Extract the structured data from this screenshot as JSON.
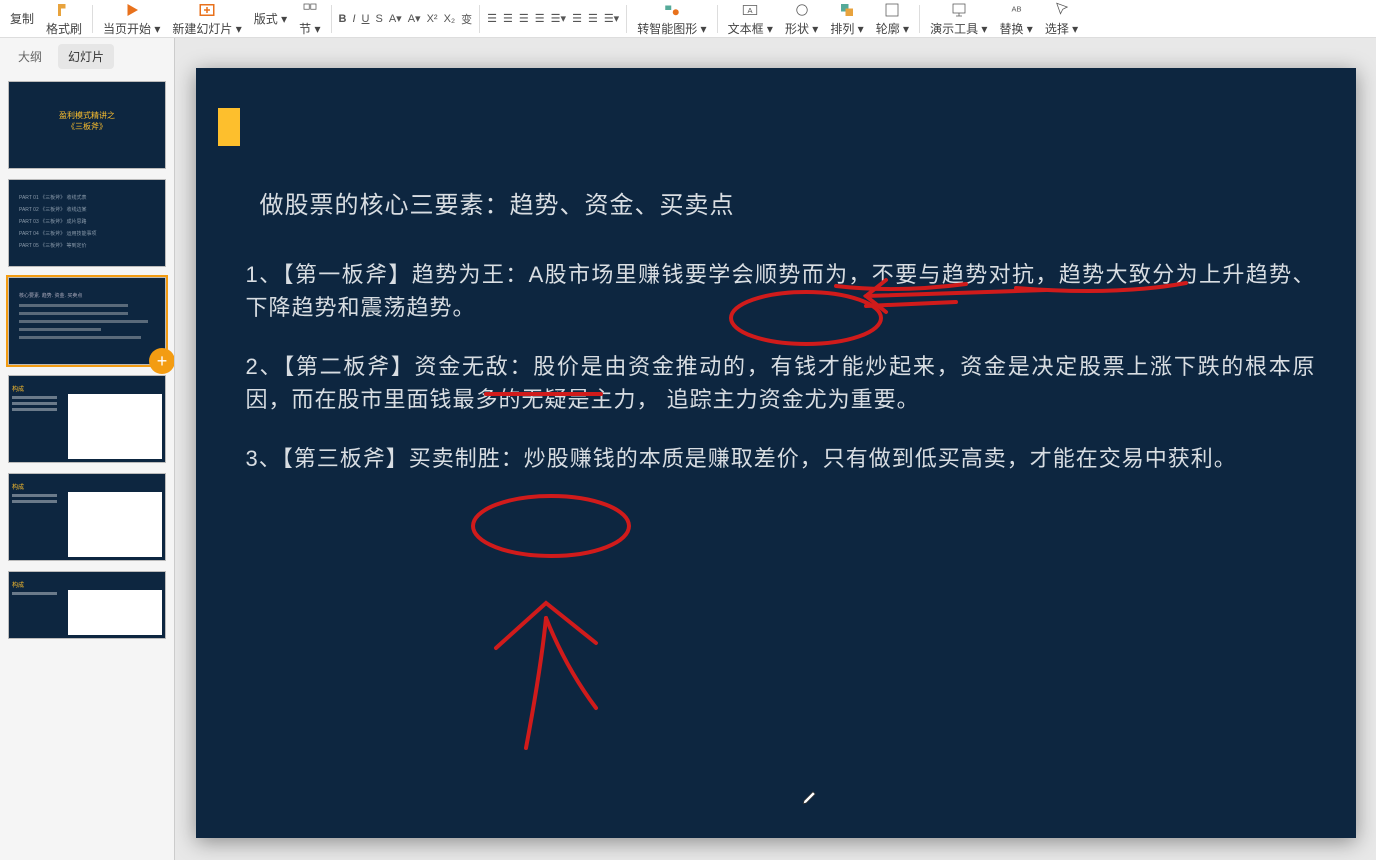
{
  "toolbar": {
    "copy": "复制",
    "format_painter": "格式刷",
    "page_start": "当页开始",
    "new_slide": "新建幻灯片",
    "layout": "版式",
    "section": "节",
    "smart_shape": "转智能图形",
    "textbox": "文本框",
    "shape": "形状",
    "arrange": "排列",
    "outline": "轮廓",
    "present_tools": "演示工具",
    "replace": "替换",
    "select": "选择"
  },
  "tabs": {
    "outline": "大纲",
    "slides": "幻灯片"
  },
  "thumbs": {
    "s1_line1": "盈利模式精讲之",
    "s1_line2": "《三板斧》",
    "s2_rows": [
      "PART 01  《三板斧》 收线式表",
      "PART 02  《三板斧》 收线边某",
      "PART 03  《三板斧》 成片思路",
      "PART 04  《三板斧》 运用技能事项",
      "PART 05  《三板斧》 等到定价"
    ],
    "s3_title": "核心要素. 趋势. 资金. 买卖点",
    "s4_title": "构成",
    "s5_title": "构成",
    "s6_title": "构成"
  },
  "slide": {
    "title": "做股票的核心三要素：趋势、资金、买卖点",
    "p1": "1、【第一板斧】趋势为王：A股市场里赚钱要学会顺势而为，不要与趋势对抗，趋势大致分为上升趋势、下降趋势和震荡趋势。",
    "p2": "2、【第二板斧】资金无敌：股价是由资金推动的，有钱才能炒起来，资金是决定股票上涨下跌的根本原因，而在股市里面钱最多的无疑是主力， 追踪主力资金尤为重要。",
    "p3": "3、【第三板斧】买卖制胜：炒股赚钱的本质是赚取差价，只有做到低买高卖，才能在交易中获利。"
  }
}
